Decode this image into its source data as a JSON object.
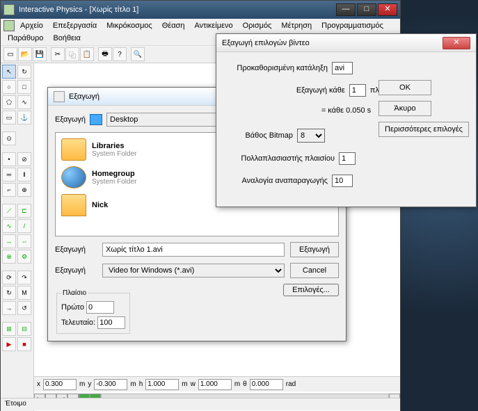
{
  "titlebar": {
    "text": "Interactive Physics - [Χωρίς τίτλο 1]"
  },
  "menu": [
    "Αρχείο",
    "Επεξεργασία",
    "Μικρόκοσμος",
    "Θέαση",
    "Αντικείμενο",
    "Ορισμός",
    "Μέτρηση",
    "Προγραμματισμός",
    "Παράθυρο",
    "Βοήθεια"
  ],
  "coords": {
    "x": {
      "label": "x",
      "value": "0.300",
      "unit": "m"
    },
    "y": {
      "label": "y",
      "value": "-0.300",
      "unit": "m"
    },
    "h": {
      "label": "h",
      "value": "1.000",
      "unit": "m"
    },
    "w": {
      "label": "w",
      "value": "1.000",
      "unit": "m"
    },
    "theta": {
      "label": "θ",
      "value": "0.000",
      "unit": "rad"
    }
  },
  "status": "Έτοιμο",
  "export_dialog": {
    "title": "Εξαγωγή",
    "location_label": "Εξαγωγή",
    "location_value": "Desktop",
    "items": [
      {
        "name": "Libraries",
        "sub": "System Folder"
      },
      {
        "name": "Homegroup",
        "sub": "System Folder"
      },
      {
        "name": "Nick",
        "sub": ""
      }
    ],
    "filename_label": "Εξαγωγή",
    "filename_value": "Χωρίς τίτλο 1.avi",
    "type_label": "Εξαγωγή",
    "type_value": "Video for Windows (*.avi)",
    "export_btn": "Εξαγωγή",
    "cancel_btn": "Cancel",
    "options_btn": "Επιλογές...",
    "frame_group": "Πλαίσιο",
    "first_label": "Πρώτο",
    "first_value": "0",
    "last_label": "Τελευταίο:",
    "last_value": "100"
  },
  "video_dialog": {
    "title": "Εξαγωγή επιλογών βίντεο",
    "ext_label": "Προκαθορισμένη κατάληξη",
    "ext_value": "avi",
    "every_label": "Εξαγωγή κάθε",
    "every_value": "1",
    "every_unit": "πλαίσια",
    "equals": "= κάθε   0.050   s",
    "depth_label": "Βάθος Bitmap",
    "depth_value": "8",
    "mult_label": "Πολλαπλασιαστής πλαισίου",
    "mult_value": "1",
    "ratio_label": "Αναλογία αναπαραγωγής",
    "ratio_value": "10",
    "ok": "OK",
    "cancel": "Άκυρο",
    "more": "Περισσότερες επιλογές"
  }
}
